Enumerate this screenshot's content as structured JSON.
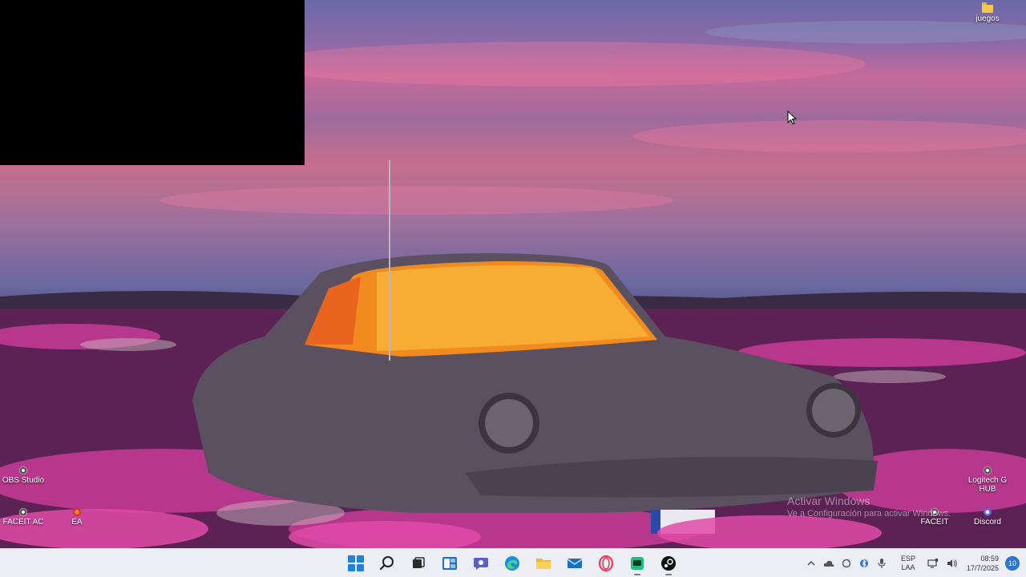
{
  "desktop": {
    "icons": [
      {
        "label": "juegos",
        "icon": "folder-icon"
      },
      {
        "label": "OBS Studio",
        "icon": "obs-icon"
      },
      {
        "label": "FACEIT AC",
        "icon": "faceit-ac-icon"
      },
      {
        "label": "EA",
        "icon": "ea-icon"
      },
      {
        "label": "Logitech G HUB",
        "icon": "logitech-icon"
      },
      {
        "label": "FACEIT",
        "icon": "faceit-icon"
      },
      {
        "label": "Discord",
        "icon": "discord-icon"
      }
    ],
    "watermark": {
      "title": "Activar Windows",
      "subtitle": "Ve a Configuración para activar Windows."
    }
  },
  "taskbar": {
    "apps": [
      {
        "name": "start",
        "icon": "windows-start-icon"
      },
      {
        "name": "search",
        "icon": "search-icon"
      },
      {
        "name": "task-view",
        "icon": "task-view-icon"
      },
      {
        "name": "widgets",
        "icon": "widgets-icon"
      },
      {
        "name": "teams-chat",
        "icon": "chat-icon"
      },
      {
        "name": "edge",
        "icon": "edge-icon"
      },
      {
        "name": "file-explorer",
        "icon": "folder-icon"
      },
      {
        "name": "mail",
        "icon": "mail-icon"
      },
      {
        "name": "opera-gx",
        "icon": "opera-icon"
      },
      {
        "name": "active-app",
        "icon": "green-app-icon"
      },
      {
        "name": "steam",
        "icon": "steam-icon"
      }
    ],
    "tray": {
      "language_line1": "ESP",
      "language_line2": "LAA",
      "time": "08:59",
      "date": "17/7/2025",
      "notification_count": "10"
    }
  },
  "colors": {
    "taskbar_bg": "#eceef3",
    "accent": "#1d83dd"
  }
}
